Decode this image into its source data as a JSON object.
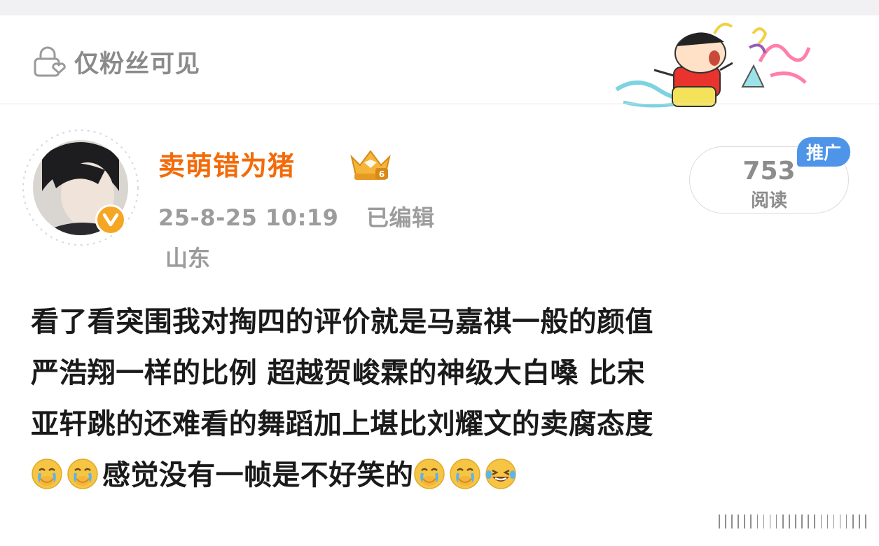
{
  "header": {
    "privacy_label": "仅粉丝可见",
    "privacy_icon": "lock-heart-icon",
    "sticker": "crayon-shinchan-sticker"
  },
  "post": {
    "author": {
      "name": "卖萌错为猪",
      "avatar": "avatar-photo",
      "verified_badge": "V",
      "level_badge": "crown-icon",
      "name_color": "#f26b0a"
    },
    "time": "25-8-25 10:19",
    "edited_label": "已编辑",
    "location": "山东",
    "reads": {
      "count": "753",
      "label": "阅读"
    },
    "promote_label": "推广",
    "promote_color": "#4e94e8",
    "body_lines": [
      "看了看突围我对掏四的评价就是马嘉祺一般的颜值",
      "严浩翔一样的比例 超越贺峻霖的神级大白嗓 比宋",
      "亚轩跳的还难看的舞蹈加上堪比刘耀文的卖腐态度",
      "感觉没有一帧是不好笑的"
    ],
    "emojis_before_line4": [
      "crying-emoji",
      "crying-emoji"
    ],
    "emojis_after_line4": [
      "crying-emoji",
      "crying-emoji",
      "laughing-tears-emoji"
    ]
  }
}
